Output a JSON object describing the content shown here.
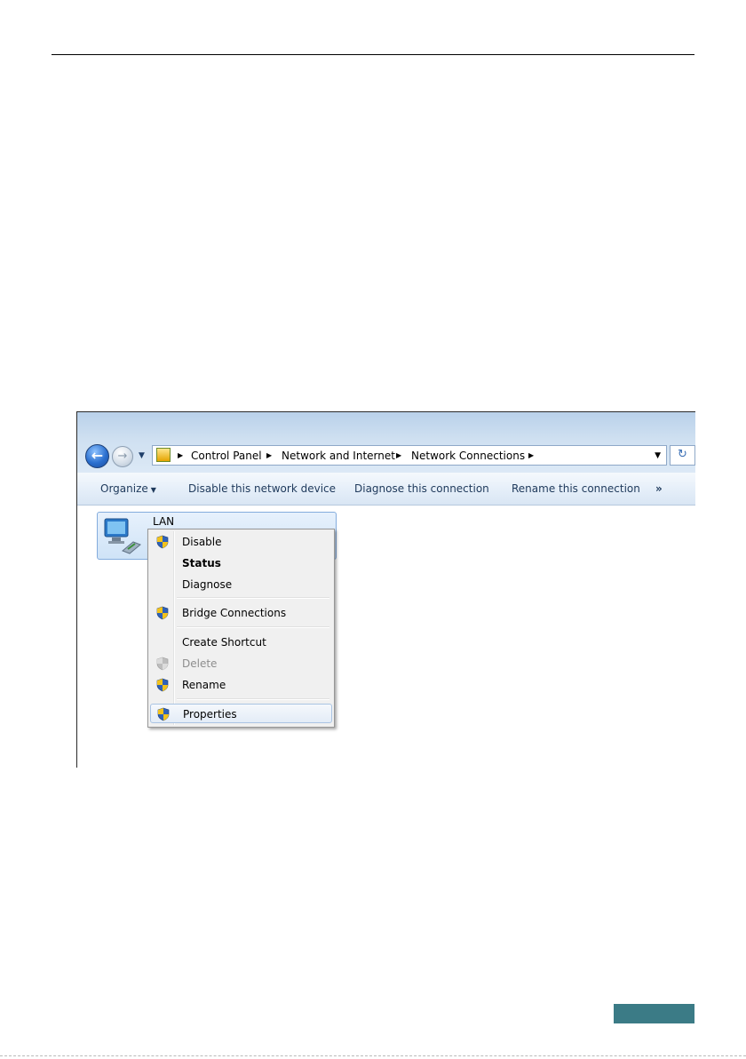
{
  "window": {
    "address": {
      "crumbs": [
        "Control Panel",
        "Network and Internet",
        "Network Connections"
      ]
    },
    "toolbar": {
      "organize": "Organize",
      "disable": "Disable this network device",
      "diagnose": "Diagnose this connection",
      "rename": "Rename this connection",
      "more": "»"
    },
    "connection": {
      "name": "LAN"
    },
    "context_menu": {
      "items": [
        {
          "label": "Disable",
          "icon": "shield-icon"
        },
        {
          "label": "Status",
          "bold": true
        },
        {
          "label": "Diagnose"
        },
        {
          "label": "Bridge Connections",
          "icon": "shield-icon"
        },
        {
          "label": "Create Shortcut"
        },
        {
          "label": "Delete",
          "icon": "shield-icon",
          "disabled": true
        },
        {
          "label": "Rename",
          "icon": "shield-icon"
        },
        {
          "label": "Properties",
          "icon": "shield-icon",
          "highlighted": true
        }
      ]
    },
    "colors": {
      "accent_tab": "#3b7b86",
      "shield_blue": "#2f62b8",
      "shield_yellow": "#f2c21b"
    }
  }
}
